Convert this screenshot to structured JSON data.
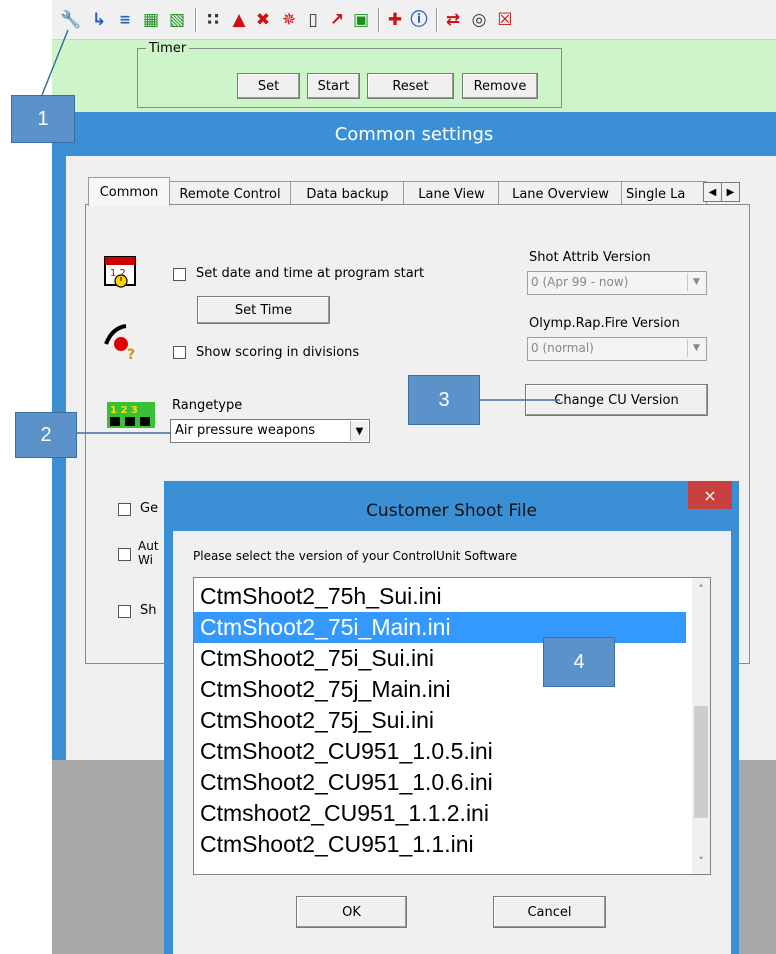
{
  "toolbar": {
    "icons": [
      "wrench-icon",
      "wrench-arrow-icon",
      "wrench-list-icon",
      "grid-flag-icon",
      "grid-arrow-icon",
      "lanes-icon",
      "warning-icon",
      "cross-icon",
      "bug-icon",
      "document-icon",
      "target-arrow-icon",
      "copy-icon",
      "add-red-icon",
      "info-icon",
      "connect-icon",
      "globe-icon",
      "delete-icon"
    ]
  },
  "timer": {
    "legend": "Timer",
    "set_label": "Set",
    "start_label": "Start",
    "reset_label": "Reset",
    "remove_label": "Remove"
  },
  "common_settings": {
    "title": "Common settings",
    "tabs": [
      "Common",
      "Remote Control",
      "Data backup",
      "Lane View",
      "Lane Overview",
      "Single La"
    ],
    "set_date_label": "Set date and time at program start",
    "set_time_label": "Set Time",
    "show_scoring_label": "Show scoring in divisions",
    "rangetype_label": "Rangetype",
    "rangetype_value": "Air pressure weapons",
    "shot_attrib_label": "Shot Attrib Version",
    "shot_attrib_value": "0 (Apr 99 - now)",
    "olymp_label": "Olymp.Rap.Fire Version",
    "olymp_value": "0 (normal)",
    "change_cu_label": "Change CU Version",
    "partial_ge": "Ge",
    "partial_aut": "Aut",
    "partial_wi": "Wi",
    "partial_sh": "Sh"
  },
  "callouts": [
    "1",
    "2",
    "3",
    "4"
  ],
  "dialog": {
    "title": "Customer Shoot File",
    "close_glyph": "×",
    "prompt": "Please select the version of your ControlUnit Software",
    "items": [
      "CtmShoot2_75h_Sui.ini",
      "CtmShoot2_75i_Main.ini",
      "CtmShoot2_75i_Sui.ini",
      "CtmShoot2_75j_Main.ini",
      "CtmShoot2_75j_Sui.ini",
      "CtmShoot2_CU951_1.0.5.ini",
      "CtmShoot2_CU951_1.0.6.ini",
      "Ctmshoot2_CU951_1.1.2.ini",
      "CtmShoot2_CU951_1.1.ini"
    ],
    "selected_index": 1,
    "ok_label": "OK",
    "cancel_label": "Cancel"
  },
  "colors": {
    "accent": "#3b8fd4",
    "selection": "#3399ff",
    "timer_bg": "#cdf5c9",
    "callout": "#5b92c9"
  }
}
